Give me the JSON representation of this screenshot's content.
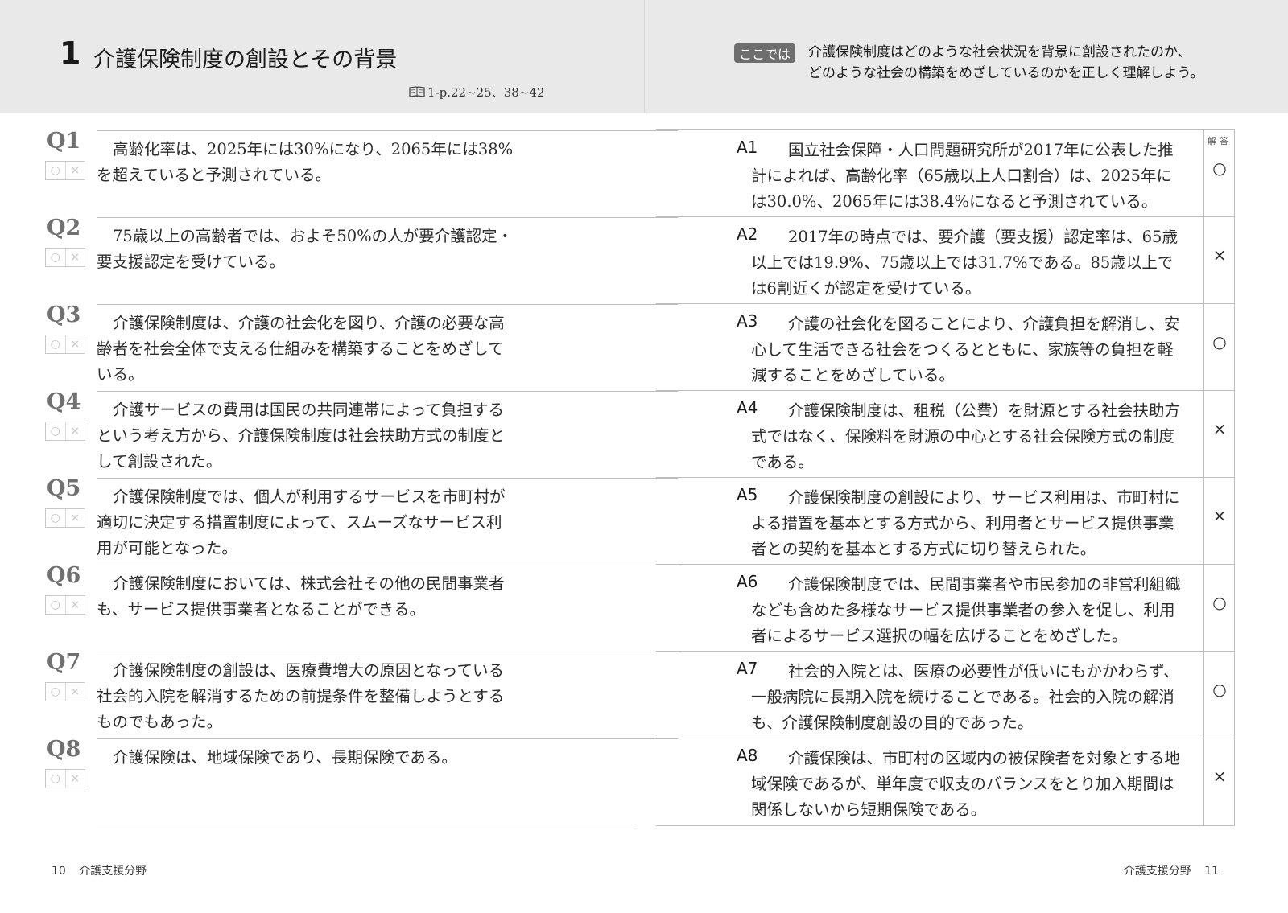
{
  "header": {
    "chapter_number": "1",
    "chapter_title": "介護保険制度の創設とその背景",
    "reference": "1-p.22~25、38~42",
    "koko_badge": "ここでは",
    "intro_lines": [
      "介護保険制度はどのような社会状況を背景に創設されたのか、",
      "どのような社会の構築をめざしているのかを正しく理解しよう。"
    ]
  },
  "check_marks": [
    "○",
    "×"
  ],
  "questions": [
    {
      "label": "Q1",
      "lines": [
        "高齢化率は、2025年には30%になり、2065年には38%",
        "を超えていると予測されている。"
      ]
    },
    {
      "label": "Q2",
      "lines": [
        "75歳以上の高齢者では、およそ50%の人が要介護認定・",
        "要支援認定を受けている。"
      ]
    },
    {
      "label": "Q3",
      "lines": [
        "介護保険制度は、介護の社会化を図り、介護の必要な高",
        "齢者を社会全体で支える仕組みを構築することをめざして",
        "いる。"
      ]
    },
    {
      "label": "Q4",
      "lines": [
        "介護サービスの費用は国民の共同連帯によって負担する",
        "という考え方から、介護保険制度は社会扶助方式の制度と",
        "して創設された。"
      ]
    },
    {
      "label": "Q5",
      "lines": [
        "介護保険制度では、個人が利用するサービスを市町村が",
        "適切に決定する措置制度によって、スムーズなサービス利",
        "用が可能となった。"
      ]
    },
    {
      "label": "Q6",
      "lines": [
        "介護保険制度においては、株式会社その他の民間事業者",
        "も、サービス提供事業者となることができる。"
      ]
    },
    {
      "label": "Q7",
      "lines": [
        "介護保険制度の創設は、医療費増大の原因となっている",
        "社会的入院を解消するための前提条件を整備しようとする",
        "ものでもあった。"
      ]
    },
    {
      "label": "Q8",
      "lines": [
        "介護保険は、地域保険であり、長期保険である。"
      ]
    }
  ],
  "answers_header": "解答",
  "answers": [
    {
      "label": "A1",
      "mark": "○",
      "lines": [
        "国立社会保障・人口問題研究所が2017年に公表した推",
        "計によれば、高齢化率（65歳以上人口割合）は、2025年に",
        "は30.0%、2065年には38.4%になると予測されている。"
      ]
    },
    {
      "label": "A2",
      "mark": "×",
      "lines": [
        "2017年の時点では、要介護（要支援）認定率は、65歳",
        "以上では19.9%、75歳以上では31.7%である。85歳以上で",
        "は6割近くが認定を受けている。"
      ]
    },
    {
      "label": "A3",
      "mark": "○",
      "lines": [
        "介護の社会化を図ることにより、介護負担を解消し、安",
        "心して生活できる社会をつくるとともに、家族等の負担を軽",
        "減することをめざしている。"
      ]
    },
    {
      "label": "A4",
      "mark": "×",
      "lines": [
        "介護保険制度は、租税（公費）を財源とする社会扶助方",
        "式ではなく、保険料を財源の中心とする社会保険方式の制度",
        "である。"
      ]
    },
    {
      "label": "A5",
      "mark": "×",
      "lines": [
        "介護保険制度の創設により、サービス利用は、市町村に",
        "よる措置を基本とする方式から、利用者とサービス提供事業",
        "者との契約を基本とする方式に切り替えられた。"
      ]
    },
    {
      "label": "A6",
      "mark": "○",
      "lines": [
        "介護保険制度では、民間事業者や市民参加の非営利組織",
        "なども含めた多様なサービス提供事業者の参入を促し、利用",
        "者によるサービス選択の幅を広げることをめざした。"
      ]
    },
    {
      "label": "A7",
      "mark": "○",
      "lines": [
        "社会的入院とは、医療の必要性が低いにもかかわらず、",
        "一般病院に長期入院を続けることである。社会的入院の解消",
        "も、介護保険制度創設の目的であった。"
      ]
    },
    {
      "label": "A8",
      "mark": "×",
      "lines": [
        "介護保険は、市町村の区域内の被保険者を対象とする地",
        "域保険であるが、単年度で収支のバランスをとり加入期間は",
        "関係しないから短期保険である。"
      ]
    }
  ],
  "footer": {
    "left_page": "10",
    "left_section": "介護支援分野",
    "right_section": "介護支援分野",
    "right_page": "11"
  }
}
